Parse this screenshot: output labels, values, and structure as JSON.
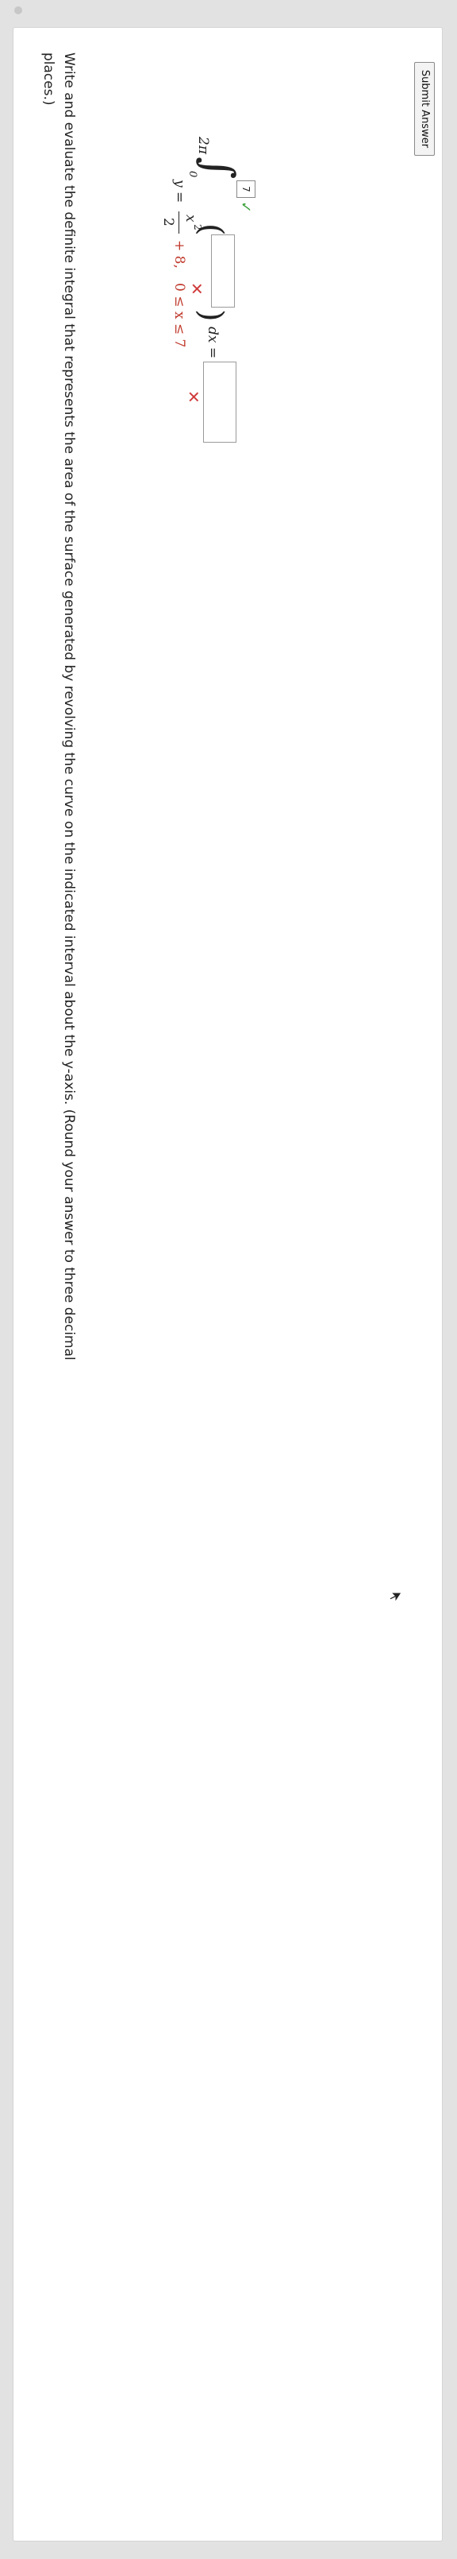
{
  "question": {
    "line1": "Write and evaluate the definite integral that represents the area of the surface generated by revolving the curve on the indicated interval about the y-axis. (Round your answer to three decimal",
    "line2": "places.)"
  },
  "equation": {
    "lhs": "y =",
    "numerator": "x",
    "exponent": "2",
    "denominator": "2",
    "plus_const": "+ 8,",
    "interval": "0 ≤ x ≤ 7"
  },
  "integral": {
    "coefficient": "2π",
    "lower_limit": "0",
    "upper_limit_value": "7",
    "integrand_value": "",
    "result_label": "dx =",
    "result_value": ""
  },
  "status": {
    "upper_limit": "correct",
    "integrand": "incorrect",
    "result": "incorrect"
  },
  "colors": {
    "correct": "#3aa03a",
    "incorrect": "#d03a3a",
    "highlight_red": "#c0392b"
  },
  "icons": {
    "check": "check-icon",
    "cross": "cross-icon",
    "cursor": "cursor-icon"
  },
  "submit": {
    "label": "Submit Answer"
  }
}
